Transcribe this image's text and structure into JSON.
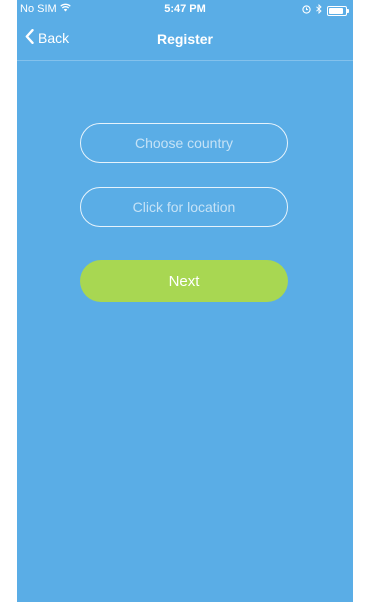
{
  "status_bar": {
    "carrier": "No SIM",
    "time": "5:47 PM",
    "battery_level": 0.9
  },
  "nav": {
    "back_label": "Back",
    "title": "Register"
  },
  "form": {
    "country_label": "Choose country",
    "location_label": "Click for location",
    "next_label": "Next"
  },
  "colors": {
    "background": "#5aade6",
    "accent_green": "#a8d752",
    "text": "#ffffff"
  },
  "icons": [
    "wifi-icon",
    "alarm-icon",
    "bluetooth-icon",
    "battery-icon",
    "chevron-left-icon"
  ]
}
